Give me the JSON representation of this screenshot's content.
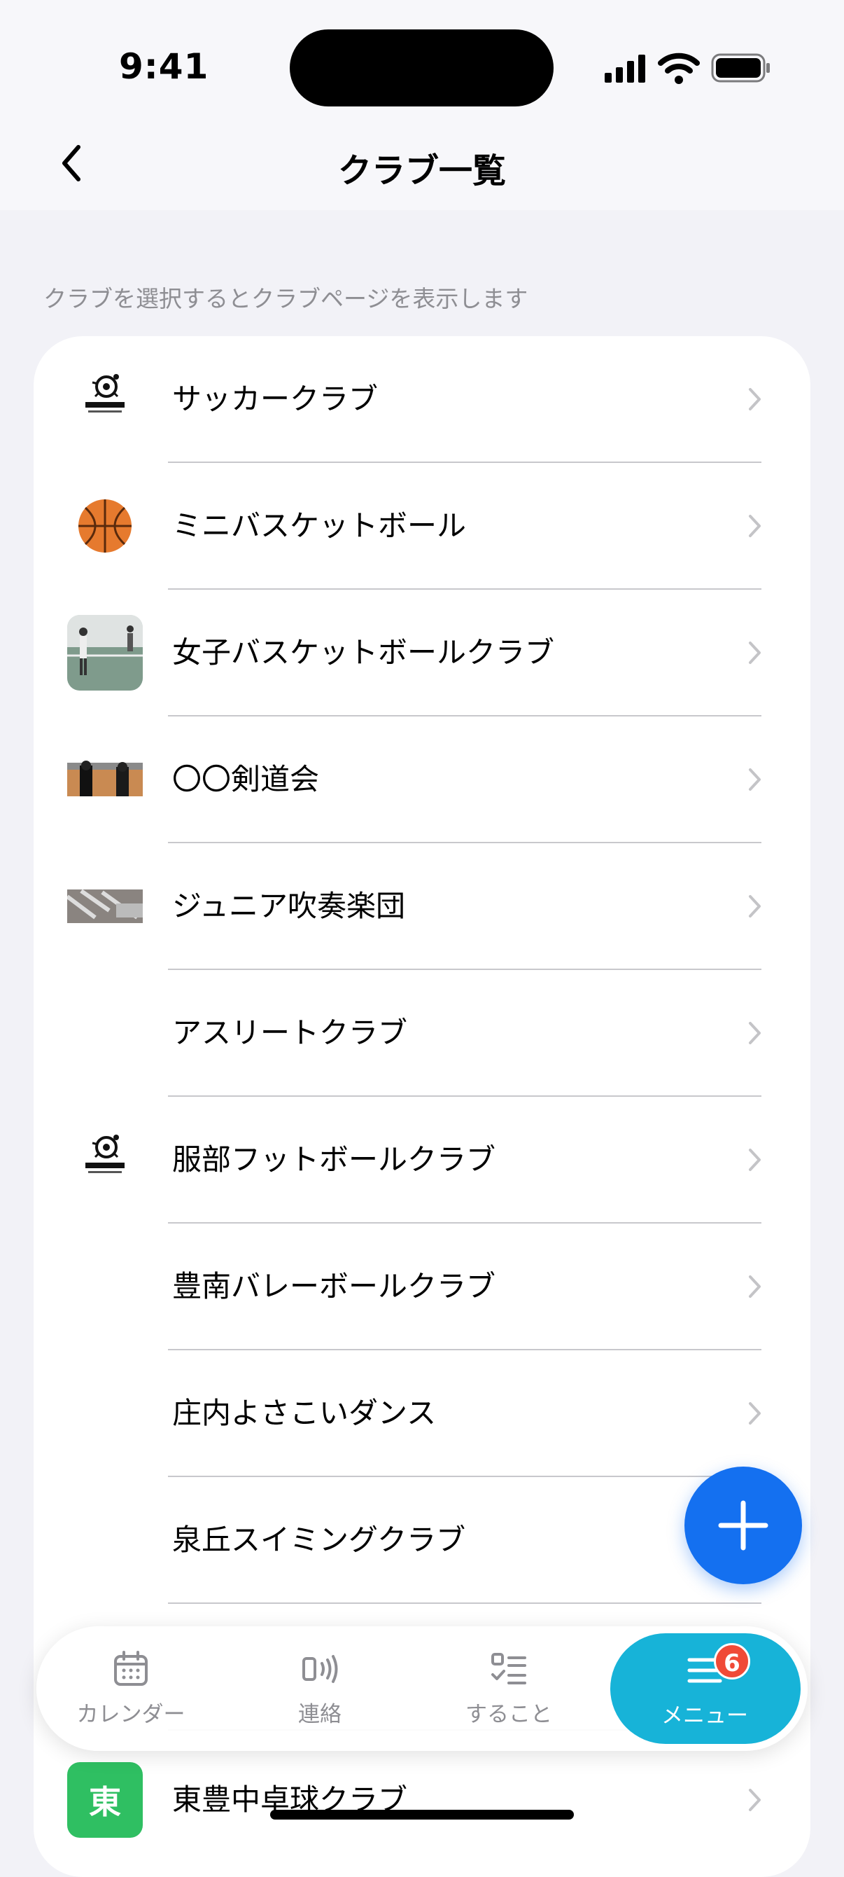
{
  "status_bar": {
    "time": "9:41"
  },
  "header": {
    "title": "クラブ一覧"
  },
  "hint": "クラブを選択するとクラブページを表示します",
  "clubs": [
    {
      "name": "サッカークラブ",
      "thumb": "breakers-logo"
    },
    {
      "name": "ミニバスケットボール",
      "thumb": "basketball-icon"
    },
    {
      "name": "女子バスケットボールクラブ",
      "thumb": "tennis-photo"
    },
    {
      "name": "〇〇剣道会",
      "thumb": "kendo-photo"
    },
    {
      "name": "ジュニア吹奏楽団",
      "thumb": "band-photo"
    },
    {
      "name": "アスリートクラブ",
      "thumb": ""
    },
    {
      "name": "服部フットボールクラブ",
      "thumb": "breakers-logo"
    },
    {
      "name": "豊南バレーボールクラブ",
      "thumb": ""
    },
    {
      "name": "庄内よさこいダンス",
      "thumb": ""
    },
    {
      "name": "泉丘スイミングクラブ",
      "thumb": ""
    },
    {
      "name": "",
      "thumb": ""
    },
    {
      "name": "東豊中卓球クラブ",
      "thumb": "letter",
      "letter": "東"
    }
  ],
  "tabs": [
    {
      "label": "カレンダー",
      "icon": "calendar-icon"
    },
    {
      "label": "連絡",
      "icon": "broadcast-icon"
    },
    {
      "label": "すること",
      "icon": "checklist-icon"
    },
    {
      "label": "メニュー",
      "icon": "menu-icon",
      "badge": "6",
      "active": true
    }
  ],
  "colors": {
    "accent": "#1470f0",
    "active_tab": "#17b3d8",
    "badge": "#f04a37",
    "letter_avatar": "#2fbf62"
  }
}
